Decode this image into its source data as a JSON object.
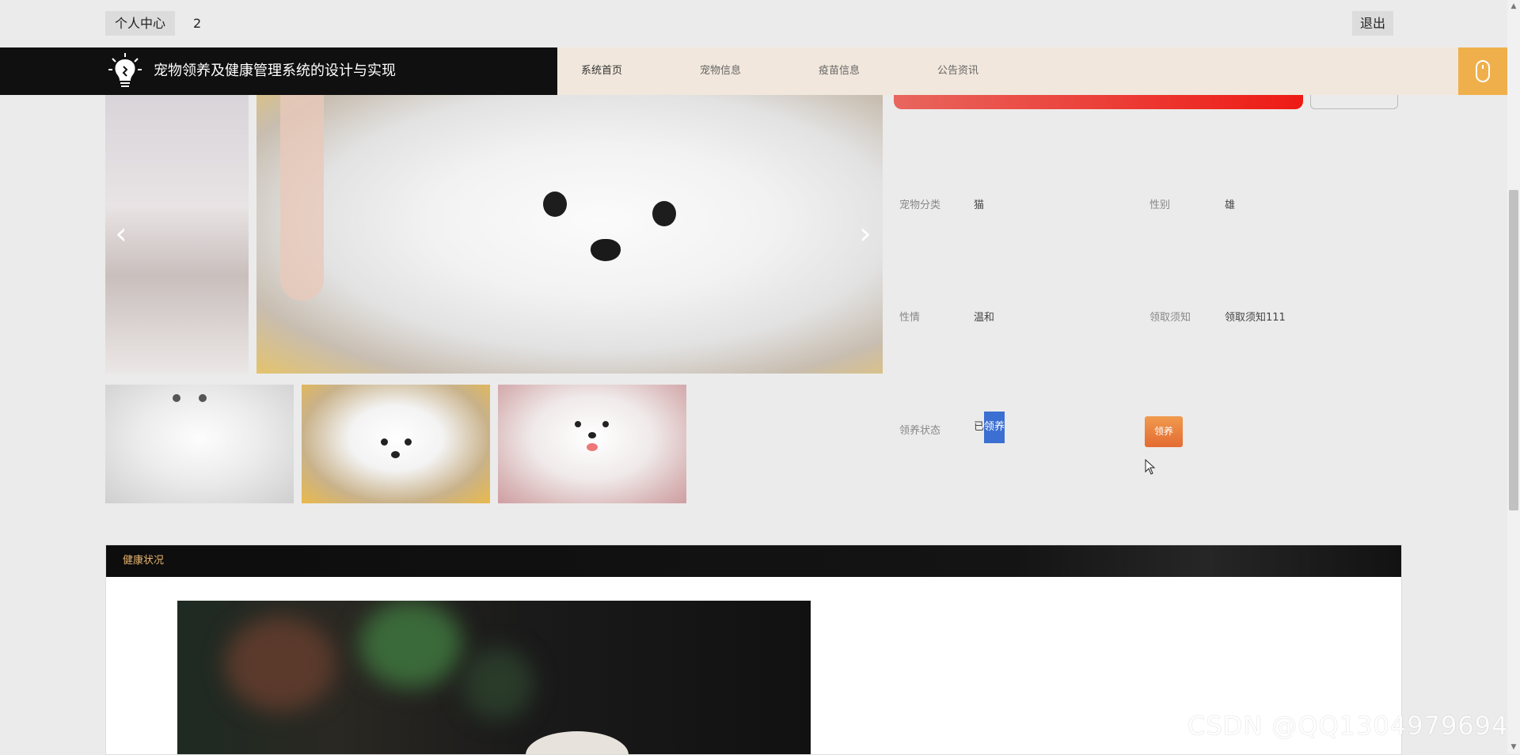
{
  "topbar": {
    "user_center": "个人中心",
    "username": "2",
    "logout": "退出"
  },
  "nav": {
    "site_title": "宠物领养及健康管理系统的设计与实现",
    "items": [
      {
        "label": "系统首页"
      },
      {
        "label": "宠物信息"
      },
      {
        "label": "疫苗信息"
      },
      {
        "label": "公告资讯"
      }
    ]
  },
  "carousel": {
    "prev_icon": "‹",
    "next_icon": "›"
  },
  "details": {
    "category_label": "宠物分类",
    "category_value": "猫",
    "gender_label": "性别",
    "gender_value": "雄",
    "temper_label": "性情",
    "temper_value": "温和",
    "notice_label": "领取须知",
    "notice_value": "领取须知111",
    "status_label": "领养状态",
    "status_prefix": "已",
    "status_selected": "领养",
    "adopt_button": "领养"
  },
  "health": {
    "title": "健康状况"
  },
  "watermark": "CSDN @QQ1304979694",
  "colors": {
    "nav_dark": "#101010",
    "menu_bg": "#f1e7dc",
    "accent_orange": "#efb04c",
    "health_title": "#e7b46f"
  }
}
